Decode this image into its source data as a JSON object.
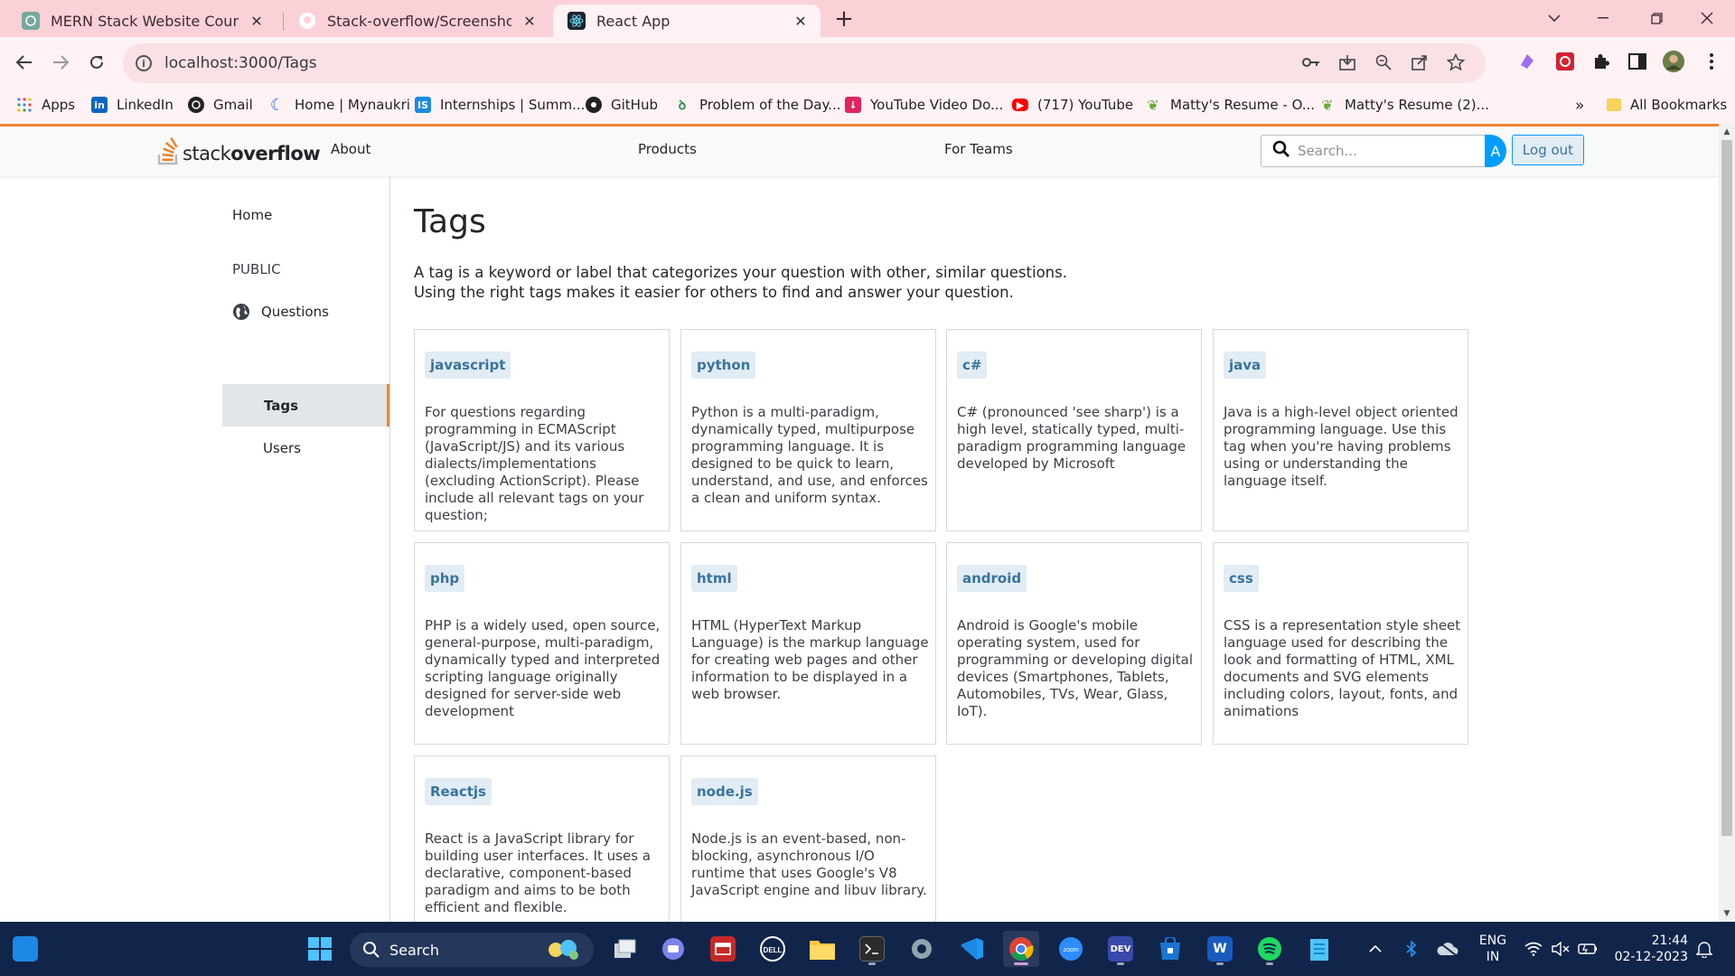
{
  "browser": {
    "tabs": [
      {
        "title": "MERN Stack Website Course",
        "icon": "chatgpt-icon"
      },
      {
        "title": "Stack-overflow/Screenshots/Qu",
        "icon": "github-icon"
      },
      {
        "title": "React App",
        "icon": "react-icon"
      }
    ],
    "close_glyph": "✕",
    "new_tab_glyph": "+",
    "url": "localhost:3000/Tags",
    "bookmarks": [
      {
        "label": "Apps",
        "icon": "apps-grid-icon"
      },
      {
        "label": "LinkedIn",
        "icon": "linkedin-icon"
      },
      {
        "label": "Gmail",
        "icon": "gmail-icon"
      },
      {
        "label": "Home | Mynaukri",
        "icon": "mynaukri-icon"
      },
      {
        "label": "Internships | Summ...",
        "icon": "internshala-icon"
      },
      {
        "label": "GitHub",
        "icon": "github-icon"
      },
      {
        "label": "Problem of the Day...",
        "icon": "gfg-icon"
      },
      {
        "label": "YouTube Video Do...",
        "icon": "downloader-icon"
      },
      {
        "label": "(717) YouTube",
        "icon": "youtube-icon"
      },
      {
        "label": "Matty's Resume - O...",
        "icon": "leaf-icon"
      },
      {
        "label": "Matty's Resume (2)...",
        "icon": "leaf-icon"
      }
    ],
    "bookmarks_overflow": "»",
    "all_bookmarks": "All Bookmarks",
    "colors": {
      "frame": "#fbd1d8",
      "toolbar": "#fff2f5"
    }
  },
  "site": {
    "logo_light": "stack",
    "logo_bold": "overflow",
    "nav": {
      "about": "About",
      "products": "Products",
      "for_teams": "For Teams"
    },
    "search_placeholder": "Search...",
    "avatar_letter": "A",
    "logout_label": "Log out",
    "colors": {
      "accent": "#ef8236",
      "tag_bg": "#e1ecf4",
      "tag_text": "#39739d",
      "avatar": "#009dff"
    }
  },
  "sidebar": {
    "home": "Home",
    "section": "PUBLIC",
    "questions": "Questions",
    "tags": "Tags",
    "users": "Users"
  },
  "page": {
    "title": "Tags",
    "intro_line1": "A tag is a keyword or label that categorizes your question with other, similar questions.",
    "intro_line2": "Using the right tags makes it easier for others to find and answer your question."
  },
  "tags": [
    {
      "name": "javascript",
      "desc": "For questions regarding programming in ECMAScript (JavaScript/JS) and its various dialects/implementations (excluding ActionScript). Please include all relevant tags on your question;"
    },
    {
      "name": "python",
      "desc": "Python is a multi-paradigm, dynamically typed, multipurpose programming language. It is designed to be quick to learn, understand, and use, and enforces a clean and uniform syntax."
    },
    {
      "name": "c#",
      "desc": "C# (pronounced 'see sharp') is a high level, statically typed, multi-paradigm programming language developed by Microsoft"
    },
    {
      "name": "java",
      "desc": "Java is a high-level object oriented programming language. Use this tag when you're having problems using or understanding the language itself."
    },
    {
      "name": "php",
      "desc": "PHP is a widely used, open source, general-purpose, multi-paradigm, dynamically typed and interpreted scripting language originally designed for server-side web development"
    },
    {
      "name": "html",
      "desc": "HTML (HyperText Markup Language) is the markup language for creating web pages and other information to be displayed in a web browser."
    },
    {
      "name": "android",
      "desc": "Android is Google's mobile operating system, used for programming or developing digital devices (Smartphones, Tablets, Automobiles, TVs, Wear, Glass, IoT)."
    },
    {
      "name": "css",
      "desc": "CSS is a representation style sheet language used for describing the look and formatting of HTML, XML documents and SVG elements including colors, layout, fonts, and animations"
    },
    {
      "name": "Reactjs",
      "desc": "React is a JavaScript library for building user interfaces. It uses a declarative, component-based paradigm and aims to be both efficient and flexible."
    },
    {
      "name": "node.js",
      "desc": "Node.js is an event-based, non-blocking, asynchronous I/O runtime that uses Google's V8 JavaScript engine and libuv library."
    }
  ],
  "taskbar": {
    "search_label": "Search",
    "apps": [
      "windows-start-icon",
      "task-view-icon",
      "teams-chat-icon",
      "mcafee-icon",
      "dell-icon",
      "file-explorer-icon",
      "terminal-icon",
      "settings-icon",
      "vscode-icon",
      "chrome-icon",
      "zoom-icon",
      "dev-icon",
      "store-icon",
      "word-icon",
      "spotify-icon",
      "notepad-icon"
    ],
    "lang_top": "ENG",
    "lang_bottom": "IN",
    "time": "21:44",
    "date": "02-12-2023",
    "colors": {
      "background": "#11254a"
    }
  }
}
